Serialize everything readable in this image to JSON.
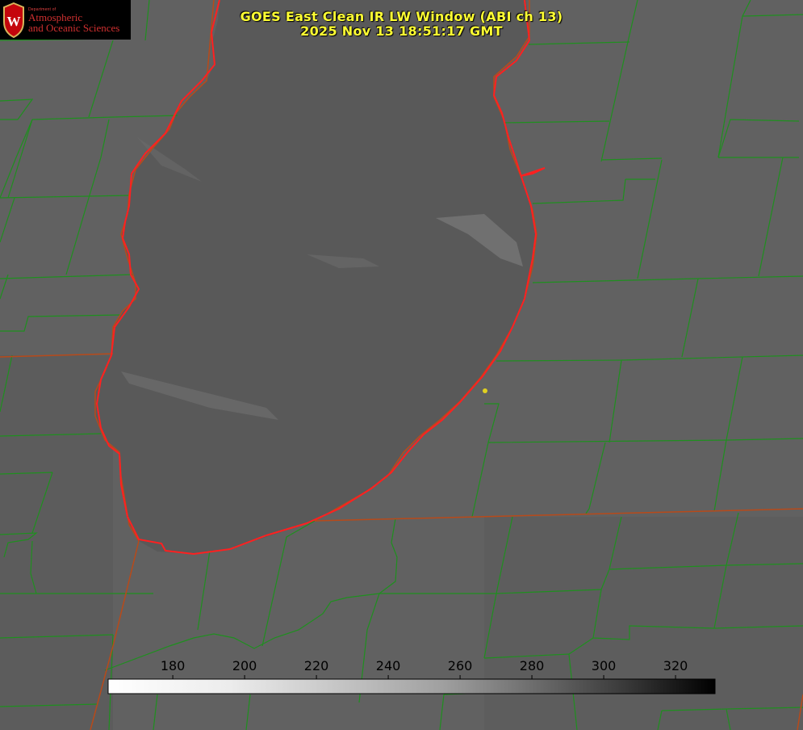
{
  "title": {
    "line1": "GOES East Clean IR LW Window (ABI ch 13)",
    "line2": "2025 Nov 13 18:51:17 GMT"
  },
  "logo": {
    "department_small": "Department of",
    "line1": "Atmospheric",
    "line2": "and Oceanic Sciences",
    "crest_letter": "W"
  },
  "colorbar": {
    "ticks": [
      "180",
      "200",
      "220",
      "240",
      "260",
      "280",
      "300",
      "320"
    ],
    "range": [
      162,
      331
    ],
    "colormap": "white-to-black",
    "label_color": "#000000"
  },
  "colors": {
    "background": "#5f5f5f",
    "lake": "#5a5a5a",
    "coastline": "#ff2020",
    "county_lines": "#1f8f1f",
    "state_lines": "#b84a1a",
    "title_text": "#ffff33",
    "marker": "#e0d020"
  },
  "icons": [
    "uw-crest-icon",
    "location-marker-icon"
  ]
}
